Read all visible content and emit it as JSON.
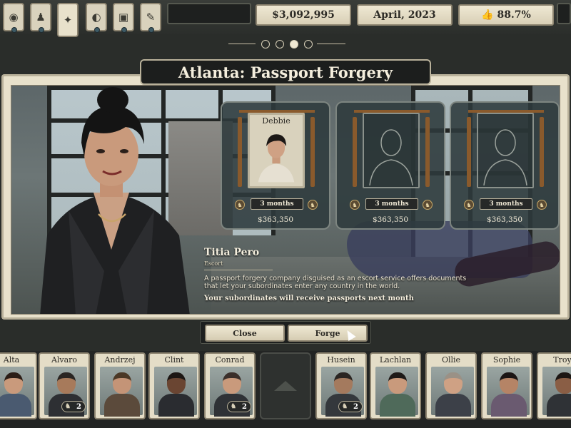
{
  "topbar": {
    "icons": [
      {
        "name": "home-icon",
        "glyph": "◉"
      },
      {
        "name": "agent-icon",
        "glyph": "♟"
      },
      {
        "name": "compass-icon",
        "glyph": "✦"
      },
      {
        "name": "globe-icon",
        "glyph": "◐"
      },
      {
        "name": "briefcase-icon",
        "glyph": "▣"
      },
      {
        "name": "clipboard-icon",
        "glyph": "✎"
      }
    ],
    "money": "$3,092,995",
    "date": "April, 2023",
    "approval": "👍 88.7%"
  },
  "title": "Atlanta: Passport Forgery",
  "slots": [
    {
      "name": "Debbie",
      "duration": "3 months",
      "cost": "$363,350",
      "filled": true
    },
    {
      "name": "",
      "duration": "3 months",
      "cost": "$363,350",
      "filled": false
    },
    {
      "name": "",
      "duration": "3 months",
      "cost": "$363,350",
      "filled": false
    }
  ],
  "info": {
    "name": "Titia Pero",
    "role": "Escort",
    "description": "A passport forgery company disguised as an escort service offers documents that let your subordinates enter any country in the world.",
    "result": "Your subordinates will receive passports next month"
  },
  "buttons": {
    "close": "Close",
    "forge": "Forge"
  },
  "roster": [
    {
      "name": "Alta",
      "badge": "",
      "skin": "#c99a7c",
      "hair": "#2b1d16",
      "shirt": "#4a5a70"
    },
    {
      "name": "Alvaro",
      "badge": "2",
      "skin": "#a77a5b",
      "hair": "#2a2522",
      "shirt": "#2d2f33"
    },
    {
      "name": "Andrzej",
      "badge": "",
      "skin": "#c49477",
      "hair": "#4b3826",
      "shirt": "#5b4a3b"
    },
    {
      "name": "Clint",
      "badge": "",
      "skin": "#6a4532",
      "hair": "#1c1613",
      "shirt": "#2a2c30"
    },
    {
      "name": "Conrad",
      "badge": "2",
      "skin": "#c99a7c",
      "hair": "#3a2f2a",
      "shirt": "#2f3236"
    },
    {
      "name": "Husein",
      "badge": "2",
      "skin": "#a47a5e",
      "hair": "#2a2522",
      "shirt": "#34383c"
    },
    {
      "name": "Lachlan",
      "badge": "",
      "skin": "#c99a7c",
      "hair": "#1e1a18",
      "shirt": "#4f6a5a"
    },
    {
      "name": "Ollie",
      "badge": "",
      "skin": "#cfa184",
      "hair": "#9a9186",
      "shirt": "#3c4048"
    },
    {
      "name": "Sophie",
      "badge": "",
      "skin": "#b58466",
      "hair": "#1b1514",
      "shirt": "#6a5a70"
    },
    {
      "name": "Troy",
      "badge": "",
      "skin": "#8a5e45",
      "hair": "#1c1613",
      "shirt": "#2f3236"
    }
  ],
  "pager": {
    "count": 4,
    "active": 2
  }
}
